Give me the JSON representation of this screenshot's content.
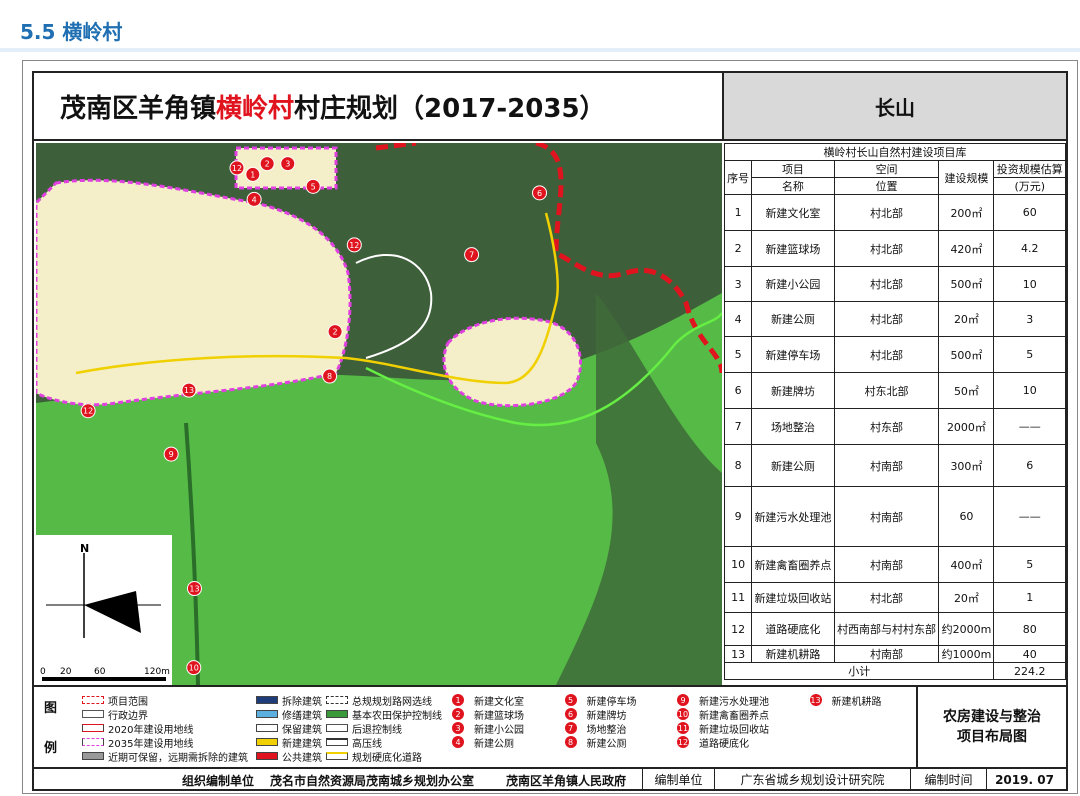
{
  "section": {
    "title": "5.5 横岭村"
  },
  "header": {
    "title_prefix": "茂南区羊角镇",
    "title_highlight": "横岭村",
    "title_suffix": "村庄规划（2017-2035）",
    "place": "长山"
  },
  "map": {
    "north_label": "N",
    "scale_labels": [
      "0",
      "20",
      "60",
      "120m"
    ],
    "markers": [
      {
        "n": "12",
        "x": 0.293,
        "y": 0.046
      },
      {
        "n": "2",
        "x": 0.337,
        "y": 0.038
      },
      {
        "n": "3",
        "x": 0.367,
        "y": 0.038
      },
      {
        "n": "1",
        "x": 0.316,
        "y": 0.058
      },
      {
        "n": "4",
        "x": 0.318,
        "y": 0.104
      },
      {
        "n": "5",
        "x": 0.404,
        "y": 0.08
      },
      {
        "n": "6",
        "x": 0.734,
        "y": 0.092
      },
      {
        "n": "12",
        "x": 0.464,
        "y": 0.188
      },
      {
        "n": "7",
        "x": 0.635,
        "y": 0.206
      },
      {
        "n": "2",
        "x": 0.436,
        "y": 0.348
      },
      {
        "n": "8",
        "x": 0.428,
        "y": 0.43
      },
      {
        "n": "13",
        "x": 0.223,
        "y": 0.456
      },
      {
        "n": "12",
        "x": 0.076,
        "y": 0.494
      },
      {
        "n": "9",
        "x": 0.197,
        "y": 0.574
      },
      {
        "n": "13",
        "x": 0.231,
        "y": 0.822
      },
      {
        "n": "10",
        "x": 0.23,
        "y": 0.968
      }
    ]
  },
  "table": {
    "title": "横岭村长山自然村建设项目库",
    "headers": {
      "seq": "序号",
      "item_top": "项目",
      "item_bottom": "名称",
      "space_top": "空间",
      "space_bottom": "位置",
      "scale": "建设规模",
      "invest_top": "投资规模估算",
      "invest_bottom": "(万元)"
    },
    "rows": [
      {
        "seq": "1",
        "name": "新建文化室",
        "loc": "村北部",
        "scale": "200㎡",
        "invest": "60"
      },
      {
        "seq": "2",
        "name": "新建篮球场",
        "loc": "村北部",
        "scale": "420㎡",
        "invest": "4.2"
      },
      {
        "seq": "3",
        "name": "新建小公园",
        "loc": "村北部",
        "scale": "500㎡",
        "invest": "10"
      },
      {
        "seq": "4",
        "name": "新建公厕",
        "loc": "村北部",
        "scale": "20㎡",
        "invest": "3"
      },
      {
        "seq": "5",
        "name": "新建停车场",
        "loc": "村北部",
        "scale": "500㎡",
        "invest": "5"
      },
      {
        "seq": "6",
        "name": "新建牌坊",
        "loc": "村东北部",
        "scale": "50㎡",
        "invest": "10"
      },
      {
        "seq": "7",
        "name": "场地整治",
        "loc": "村东部",
        "scale": "2000㎡",
        "invest": "——"
      },
      {
        "seq": "8",
        "name": "新建公厕",
        "loc": "村南部",
        "scale": "300㎡",
        "invest": "6"
      },
      {
        "seq": "9",
        "name": "新建污水处理池",
        "loc": "村南部",
        "scale": "60",
        "invest": "——"
      },
      {
        "seq": "10",
        "name": "新建禽畜圈养点",
        "loc": "村南部",
        "scale": "400㎡",
        "invest": "5"
      },
      {
        "seq": "11",
        "name": "新建垃圾回收站",
        "loc": "村北部",
        "scale": "20㎡",
        "invest": "1"
      },
      {
        "seq": "12",
        "name": "道路硬底化",
        "loc": "村西南部与村村东部",
        "scale": "约2000m",
        "invest": "80"
      },
      {
        "seq": "13",
        "name": "新建机耕路",
        "loc": "村南部",
        "scale": "约1000m",
        "invest": "40"
      }
    ],
    "subtotal_label": "小计",
    "subtotal": "224.2"
  },
  "legend": {
    "head_top": "图",
    "head_bottom": "例",
    "col1": [
      "项目范围",
      "行政边界",
      "2020年建设用地线",
      "2035年建设用地线",
      "近期可保留，远期需拆除的建筑"
    ],
    "col2": [
      "拆除建筑",
      "修缮建筑",
      "保留建筑",
      "新建建筑",
      "公共建筑"
    ],
    "col3": [
      "总规规划路网选线",
      "基本农田保护控制线",
      "后退控制线",
      "高压线",
      "规划硬底化道路"
    ],
    "projects": [
      {
        "n": "1",
        "label": "新建文化室"
      },
      {
        "n": "2",
        "label": "新建篮球场"
      },
      {
        "n": "3",
        "label": "新建小公园"
      },
      {
        "n": "4",
        "label": "新建公厕"
      },
      {
        "n": "5",
        "label": "新建停车场"
      },
      {
        "n": "6",
        "label": "新建牌坊"
      },
      {
        "n": "7",
        "label": "场地整治"
      },
      {
        "n": "8",
        "label": "新建公厕"
      },
      {
        "n": "9",
        "label": "新建污水处理池"
      },
      {
        "n": "10",
        "label": "新建禽畜圈养点"
      },
      {
        "n": "11",
        "label": "新建垃圾回收站"
      },
      {
        "n": "12",
        "label": "道路硬底化"
      },
      {
        "n": "13",
        "label": "新建机耕路"
      }
    ],
    "side_line1": "农房建设与整治",
    "side_line2": "项目布局图"
  },
  "footer": {
    "org_label": "组织编制单位",
    "org1": "茂名市自然资源局茂南城乡规划办公室",
    "org2": "茂南区羊角镇人民政府",
    "compiler_label": "编制单位",
    "compiler": "广东省城乡规划设计研究院",
    "date_label": "编制时间",
    "date": "2019. 07"
  },
  "colors": {
    "accent_blue": "#1f6fb2",
    "highlight_red": "#e0141e",
    "farmland_green": "#5fd34a",
    "village_cream": "#f4efc8",
    "boundary_magenta": "#e040e0",
    "boundary_red": "#e0141e"
  }
}
